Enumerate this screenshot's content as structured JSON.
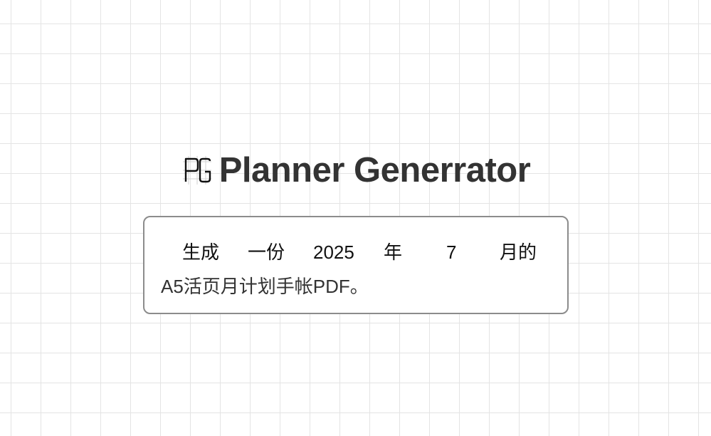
{
  "app": {
    "title": "Planner Generrator",
    "logo_icon": "pg-monogram-icon"
  },
  "prompt": {
    "prefix": "生成",
    "middle": "一份",
    "year_value": "2025",
    "year_unit": "年",
    "month_value": "7",
    "month_unit": "月的",
    "suffix": "A5活页月计划手帐PDF。"
  },
  "colors": {
    "title_text": "#333333",
    "card_border": "#8c8c8c",
    "grid_line": "#e4e4e4"
  }
}
